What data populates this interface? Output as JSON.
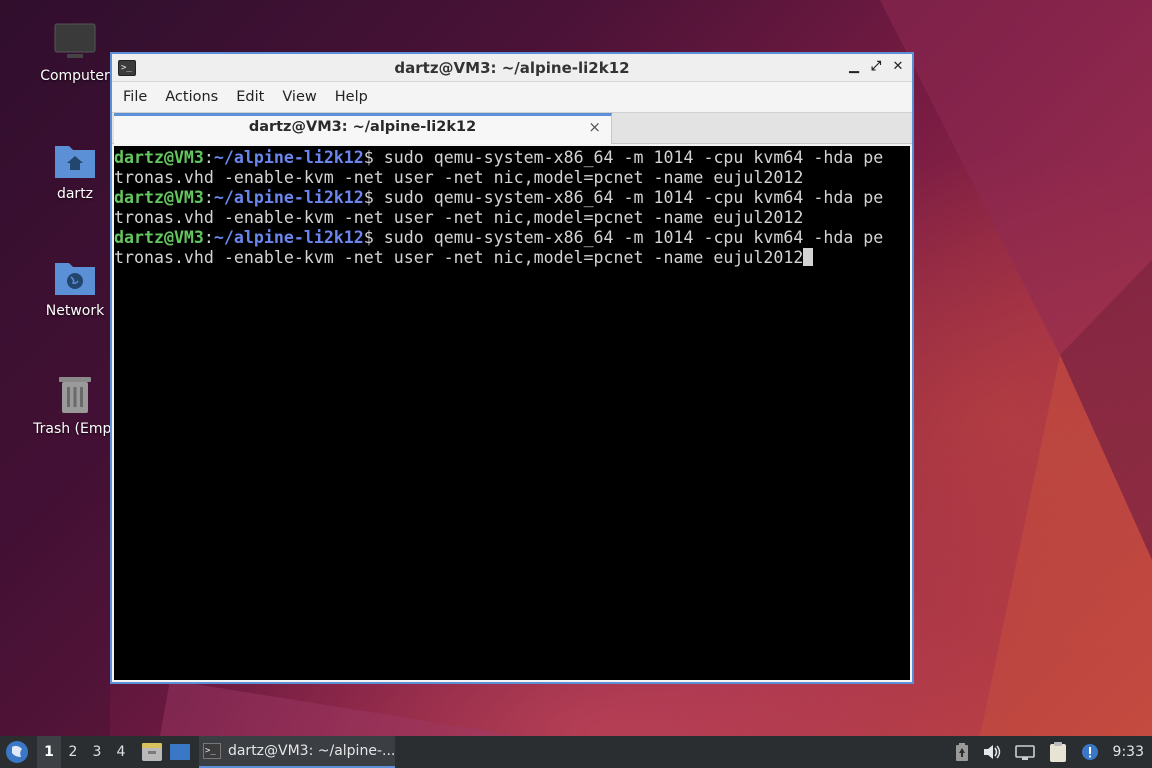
{
  "desktop": {
    "icons": [
      {
        "label": "Computer"
      },
      {
        "label": "dartz"
      },
      {
        "label": "Network"
      },
      {
        "label": "Trash (Empt"
      }
    ]
  },
  "window": {
    "title": "dartz@VM3: ~/alpine-li2k12",
    "controls": {
      "minimize": "▁",
      "maximize": "⤢",
      "close": "✕"
    },
    "menu": [
      "File",
      "Actions",
      "Edit",
      "View",
      "Help"
    ],
    "tab": {
      "label": "dartz@VM3: ~/alpine-li2k12",
      "close": "×"
    },
    "terminal": {
      "prompt_user": "dartz@VM3",
      "prompt_colon": ":",
      "prompt_path": "~/alpine-li2k12",
      "prompt_end": "$ ",
      "lines": [
        {
          "cmd": "sudo qemu-system-x86_64 -m 1014 -cpu kvm64 -hda pe",
          "wrap": "tronas.vhd -enable-kvm -net user -net nic,model=pcnet -name eujul2012"
        },
        {
          "cmd": "sudo qemu-system-x86_64 -m 1014 -cpu kvm64 -hda pe",
          "wrap": "tronas.vhd -enable-kvm -net user -net nic,model=pcnet -name eujul2012"
        },
        {
          "cmd": "sudo qemu-system-x86_64 -m 1014 -cpu kvm64 -hda pe",
          "wrap": "tronas.vhd -enable-kvm -net user -net nic,model=pcnet -name eujul2012"
        }
      ]
    }
  },
  "taskbar": {
    "workspaces": [
      "1",
      "2",
      "3",
      "4"
    ],
    "active_workspace": "1",
    "task": {
      "label": "dartz@VM3: ~/alpine-..."
    },
    "clock": "9:33"
  },
  "colors": {
    "accent": "#5b8fd6",
    "prompt_user": "#62c85e",
    "prompt_path": "#6b86ee"
  }
}
